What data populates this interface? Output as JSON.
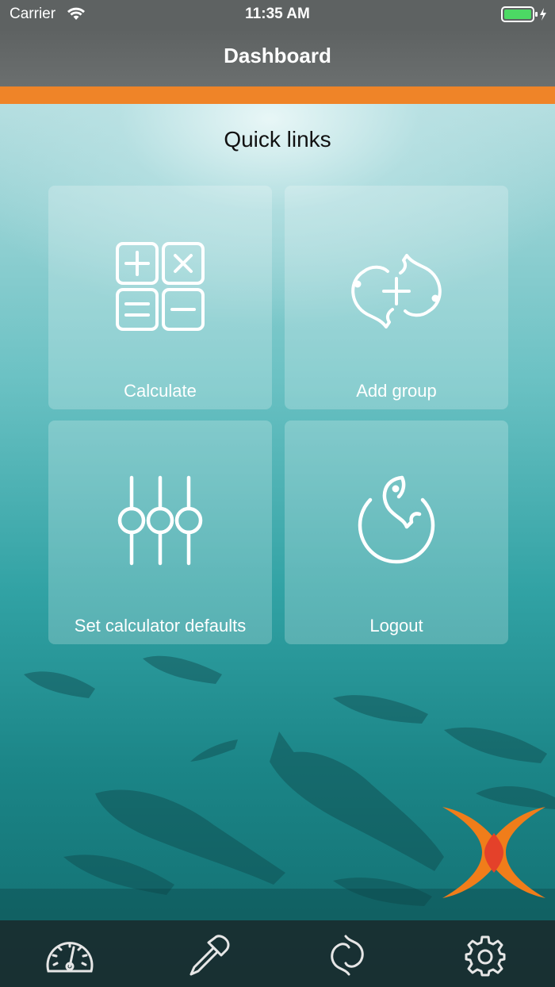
{
  "status_bar": {
    "carrier": "Carrier",
    "time": "11:35 AM"
  },
  "nav": {
    "title": "Dashboard"
  },
  "main": {
    "section_title": "Quick links",
    "tiles": [
      {
        "label": "Calculate",
        "icon": "calculator-icon"
      },
      {
        "label": "Add group",
        "icon": "add-fish-group-icon"
      },
      {
        "label": "Set calculator defaults",
        "icon": "sliders-icon"
      },
      {
        "label": "Logout",
        "icon": "fish-power-icon"
      }
    ]
  },
  "tab_bar": {
    "tabs": [
      {
        "icon": "gauge-icon"
      },
      {
        "icon": "dropper-icon"
      },
      {
        "icon": "fish-pair-icon"
      },
      {
        "icon": "gear-icon"
      }
    ]
  },
  "colors": {
    "accent": "#ef8428",
    "nav": "#5e6262",
    "logo_orange": "#f07d1a",
    "logo_red": "#e4412a"
  }
}
